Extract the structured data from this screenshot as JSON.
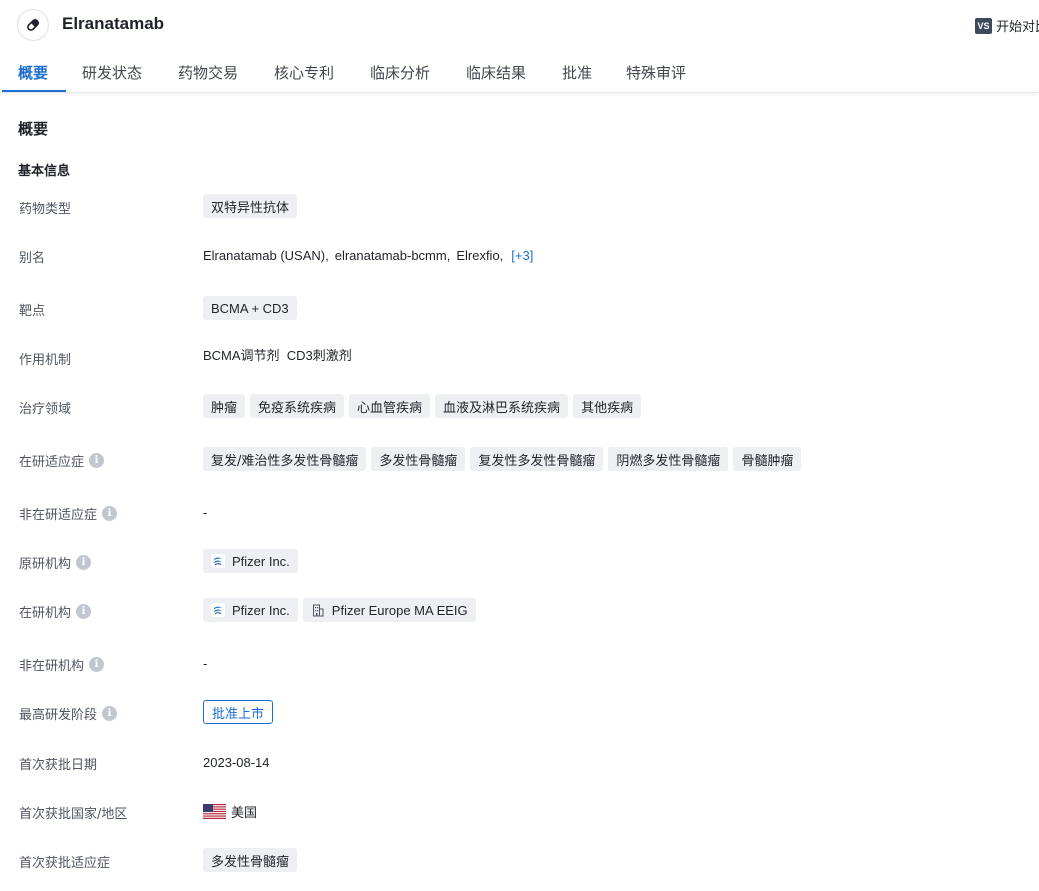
{
  "header": {
    "title": "Elranatamab",
    "compare_icon": "VS",
    "compare_label": "开始对比"
  },
  "tabs": [
    {
      "label": "概要",
      "active": true
    },
    {
      "label": "研发状态"
    },
    {
      "label": "药物交易"
    },
    {
      "label": "核心专利"
    },
    {
      "label": "临床分析"
    },
    {
      "label": "临床结果"
    },
    {
      "label": "批准"
    },
    {
      "label": "特殊审评"
    }
  ],
  "section": {
    "title": "概要",
    "subtitle": "基本信息"
  },
  "info": {
    "drug_type": {
      "label": "药物类型",
      "tags": [
        "双特异性抗体"
      ]
    },
    "alias": {
      "label": "别名",
      "values": [
        "Elranatamab (USAN),",
        "elranatamab-bcmm,",
        "Elrexfio,"
      ],
      "more": "[+3]"
    },
    "target": {
      "label": "靶点",
      "tags": [
        "BCMA + CD3"
      ]
    },
    "mechanism": {
      "label": "作用机制",
      "value": "BCMA调节剂  CD3刺激剂"
    },
    "therapy_area": {
      "label": "治疗领域",
      "tags": [
        "肿瘤",
        "免疫系统疾病",
        "心血管疾病",
        "血液及淋巴系统疾病",
        "其他疾病"
      ]
    },
    "active_indication": {
      "label": "在研适应症",
      "tags": [
        "复发/难治性多发性骨髓瘤",
        "多发性骨髓瘤",
        "复发性多发性骨髓瘤",
        "阴燃多发性骨髓瘤",
        "骨髓肿瘤"
      ]
    },
    "inactive_indication": {
      "label": "非在研适应症",
      "value": "-"
    },
    "originator": {
      "label": "原研机构",
      "orgs": [
        "Pfizer Inc."
      ]
    },
    "active_org": {
      "label": "在研机构",
      "orgs": [
        "Pfizer Inc.",
        "Pfizer Europe MA EEIG"
      ]
    },
    "inactive_org": {
      "label": "非在研机构",
      "value": "-"
    },
    "highest_phase": {
      "label": "最高研发阶段",
      "value": "批准上市"
    },
    "first_approval_date": {
      "label": "首次获批日期",
      "value": "2023-08-14"
    },
    "first_approval_country": {
      "label": "首次获批国家/地区",
      "value": "美国",
      "flag": "us-flag-icon"
    },
    "first_approval_indication": {
      "label": "首次获批适应症",
      "tags": [
        "多发性骨髓瘤"
      ]
    }
  },
  "colors": {
    "accent": "#1d6fcf",
    "tag_bg": "#edeff3",
    "label_text": "#4e5561",
    "info_icon": "#c2c7cf"
  }
}
